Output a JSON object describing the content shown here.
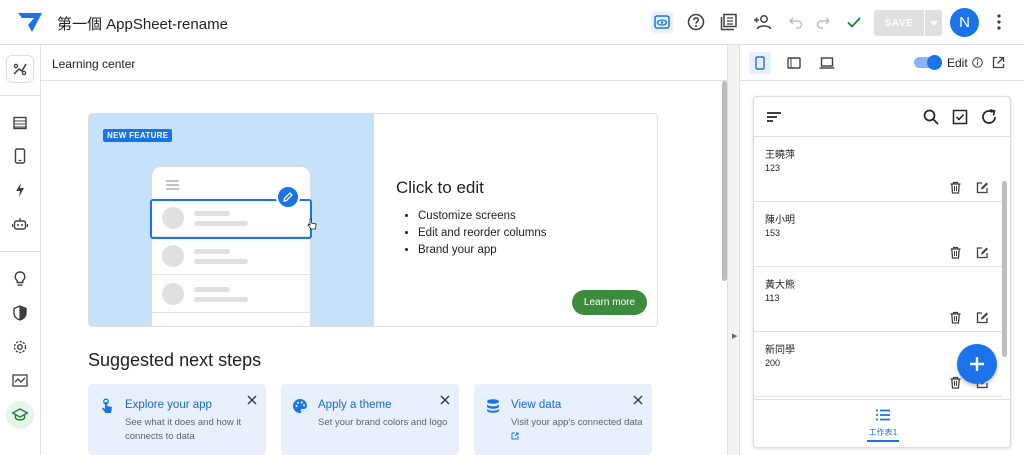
{
  "app": {
    "title": "第一個 AppSheet-rename"
  },
  "toolbar": {
    "save_label": "SAVE",
    "avatar_initial": "N",
    "icons": [
      "preview-eye-icon",
      "help-icon",
      "gallery-icon",
      "share-add-person-icon",
      "undo-icon",
      "redo-icon",
      "check-icon"
    ]
  },
  "rail": {
    "items": [
      "automation-icon",
      "data-table-icon",
      "views-phone-icon",
      "actions-bolt-icon",
      "bots-icon",
      "intelligence-bulb-icon",
      "security-shield-icon",
      "settings-gear-icon",
      "monitor-chart-icon",
      "learning-center-cap-icon"
    ]
  },
  "center": {
    "header": "Learning center",
    "feature": {
      "badge": "NEW FEATURE",
      "title": "Click to edit",
      "bullets": [
        "Customize screens",
        "Edit and reorder columns",
        "Brand your app"
      ],
      "button": "Learn more"
    },
    "steps_title": "Suggested next steps",
    "steps": [
      {
        "icon": "touch-hand-icon",
        "title": "Explore your app",
        "desc": "See what it does and how it connects to data"
      },
      {
        "icon": "palette-icon",
        "title": "Apply a theme",
        "desc": "Set your brand colors and logo"
      },
      {
        "icon": "database-icon",
        "title": "View data",
        "desc": "Visit your app's connected data"
      }
    ]
  },
  "preview": {
    "edit_label": "Edit",
    "edit_enabled": true,
    "rows": [
      {
        "name": "王曉萍",
        "value": "123"
      },
      {
        "name": "陳小明",
        "value": "153"
      },
      {
        "name": "黃大熊",
        "value": "113"
      },
      {
        "name": "新同學",
        "value": "200"
      }
    ],
    "tab_label": "工作表1"
  },
  "colors": {
    "accent": "#1a73e8",
    "learn_button": "#3d8b3d",
    "card_bg": "#e8f0fe",
    "illustration_bg": "#c6e2fb"
  }
}
